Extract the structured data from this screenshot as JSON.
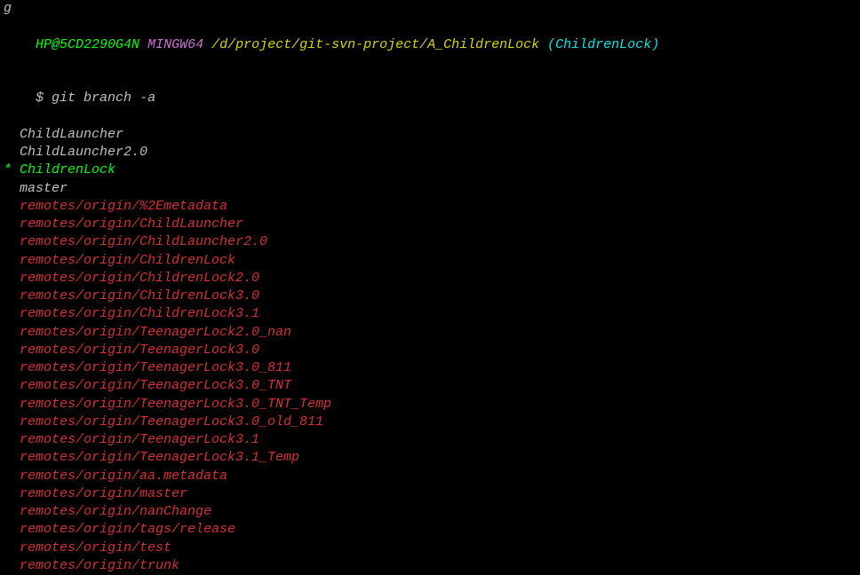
{
  "prev_char": "g",
  "prompt": {
    "user_host": "HP@5CD2290G4N",
    "mingw": "MINGW64",
    "path": "/d/project/git-svn-project/A_ChildrenLock",
    "branch": "(ChildrenLock)"
  },
  "command": {
    "symbol": "$",
    "text": "git branch -a"
  },
  "local_branches": [
    {
      "name": "ChildLauncher",
      "current": false
    },
    {
      "name": "ChildLauncher2.0",
      "current": false
    },
    {
      "name": "ChildrenLock",
      "current": true
    },
    {
      "name": "master",
      "current": false
    }
  ],
  "remote_branches": [
    "remotes/origin/%2Emetadata",
    "remotes/origin/ChildLauncher",
    "remotes/origin/ChildLauncher2.0",
    "remotes/origin/ChildrenLock",
    "remotes/origin/ChildrenLock2.0",
    "remotes/origin/ChildrenLock3.0",
    "remotes/origin/ChildrenLock3.1",
    "remotes/origin/TeenagerLock2.0_nan",
    "remotes/origin/TeenagerLock3.0",
    "remotes/origin/TeenagerLock3.0_811",
    "remotes/origin/TeenagerLock3.0_TNT",
    "remotes/origin/TeenagerLock3.0_TNT_Temp",
    "remotes/origin/TeenagerLock3.0_old_811",
    "remotes/origin/TeenagerLock3.1",
    "remotes/origin/TeenagerLock3.1_Temp",
    "remotes/origin/aa.metadata",
    "remotes/origin/master",
    "remotes/origin/nanChange",
    "remotes/origin/tags/release",
    "remotes/origin/test",
    "remotes/origin/trunk"
  ]
}
